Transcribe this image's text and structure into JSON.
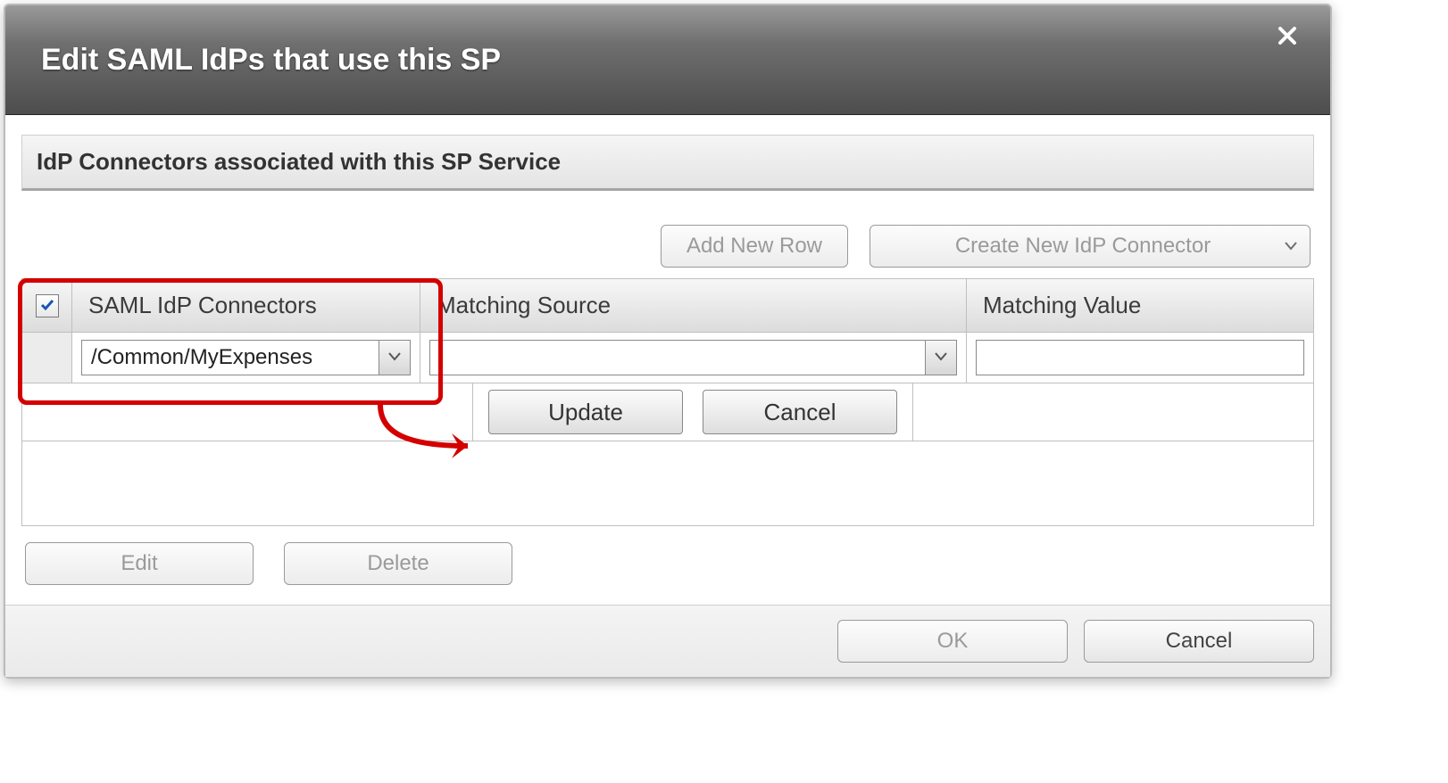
{
  "dialog": {
    "title": "Edit SAML IdPs that use this SP"
  },
  "section": {
    "heading": "IdP Connectors associated with this SP Service"
  },
  "toolbar": {
    "add_row": "Add New Row",
    "create_connector": "Create New IdP Connector"
  },
  "grid": {
    "headers": {
      "connectors": "SAML IdP Connectors",
      "matching_source": "Matching Source",
      "matching_value": "Matching Value"
    },
    "header_checkbox_checked": true,
    "row": {
      "connector_value": "/Common/MyExpenses",
      "matching_source_value": "",
      "matching_value": ""
    },
    "editor": {
      "update": "Update",
      "cancel": "Cancel"
    }
  },
  "below": {
    "edit": "Edit",
    "delete": "Delete"
  },
  "footer": {
    "ok": "OK",
    "cancel": "Cancel"
  }
}
